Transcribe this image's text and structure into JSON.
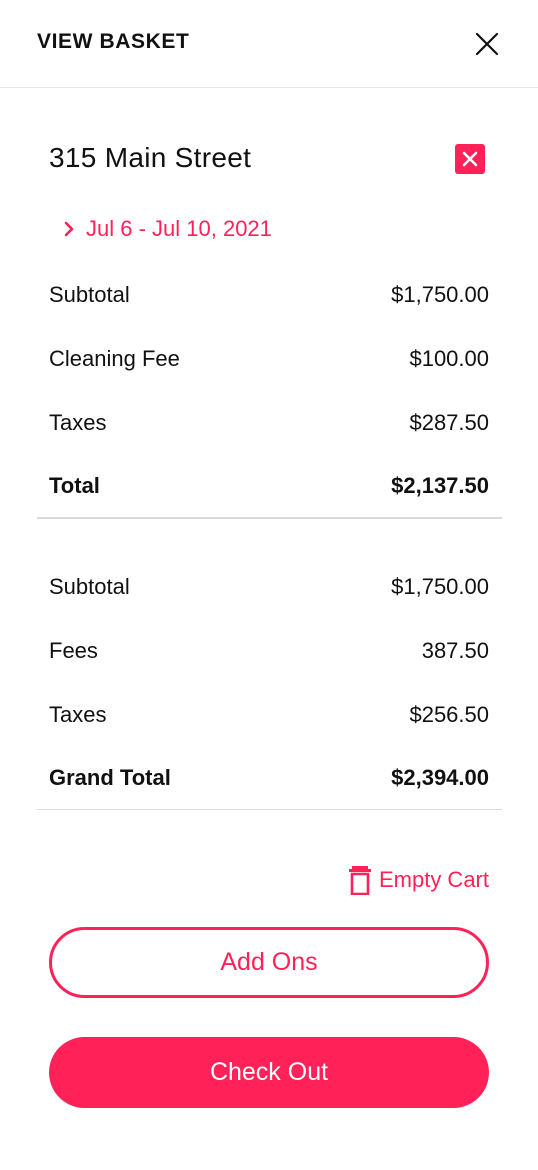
{
  "header": {
    "title": "VIEW BASKET",
    "close_icon": "close-icon"
  },
  "item": {
    "title": "315 Main Street",
    "remove_icon": "close-square-icon",
    "dates": "Jul 6 - Jul 10, 2021",
    "lines": [
      {
        "label": "Subtotal",
        "value": "$1,750.00"
      },
      {
        "label": "Cleaning Fee",
        "value": "$100.00"
      },
      {
        "label": "Taxes",
        "value": "$287.50"
      },
      {
        "label": "Total",
        "value": "$2,137.50"
      }
    ]
  },
  "summary": {
    "lines": [
      {
        "label": "Subtotal",
        "value": "$1,750.00"
      },
      {
        "label": "Fees",
        "value": "387.50"
      },
      {
        "label": "Taxes",
        "value": "$256.50"
      },
      {
        "label": "Grand Total",
        "value": "$2,394.00"
      }
    ]
  },
  "actions": {
    "empty_cart": "Empty Cart",
    "empty_cart_icon": "trash-icon",
    "add_ons": "Add Ons",
    "check_out": "Check Out"
  },
  "colors": {
    "accent": "#ff2157",
    "text": "#111111",
    "divider": "#d9d9d9"
  }
}
